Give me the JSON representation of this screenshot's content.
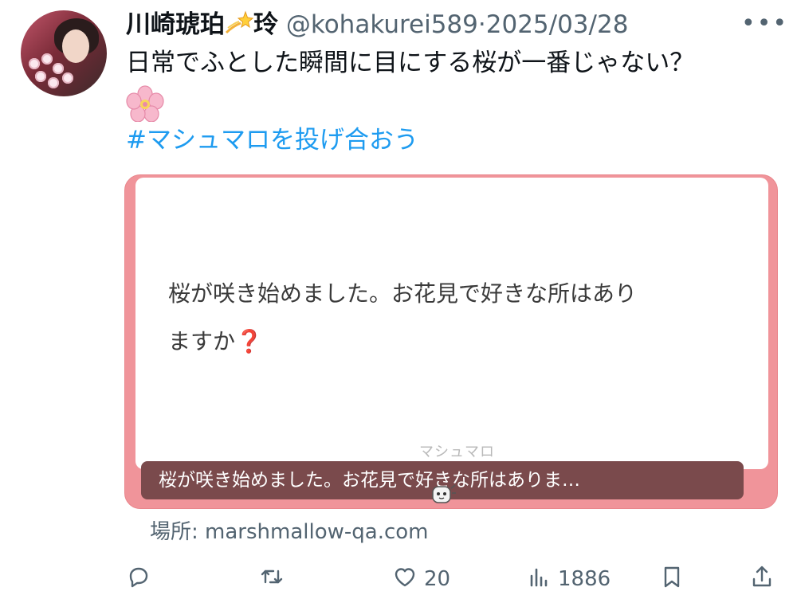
{
  "post": {
    "display_name": "川崎琥珀",
    "name_suffix": "玲",
    "handle": "@kohakurei589",
    "separator": "·",
    "date": "2025/03/28",
    "text": "日常でふとした瞬間に目にする桜が一番じゃない？",
    "hashtag": "#マシュマロを投げ合おう",
    "more_label": "•••"
  },
  "card": {
    "question_line1": "桜が咲き始めました。お花見で好きな所はあり",
    "question_line2": "ますか",
    "question_mark": "❓",
    "brand": "マシュマロ",
    "caption": "桜が咲き始めました。お花見で好きな所はありま…",
    "domain": "場所: marshmallow-qa.com"
  },
  "actions": {
    "likes": "20",
    "views": "1886"
  },
  "colors": {
    "accent": "#1d9bf0",
    "card_frame": "#f0949a",
    "caption_bg": "#7a4a4c",
    "muted": "#536471"
  },
  "icons": [
    "sparkle-icon",
    "more-icon",
    "cherry-blossom-icon",
    "reply-icon",
    "retweet-icon",
    "like-icon",
    "views-icon",
    "bookmark-icon",
    "share-icon"
  ]
}
